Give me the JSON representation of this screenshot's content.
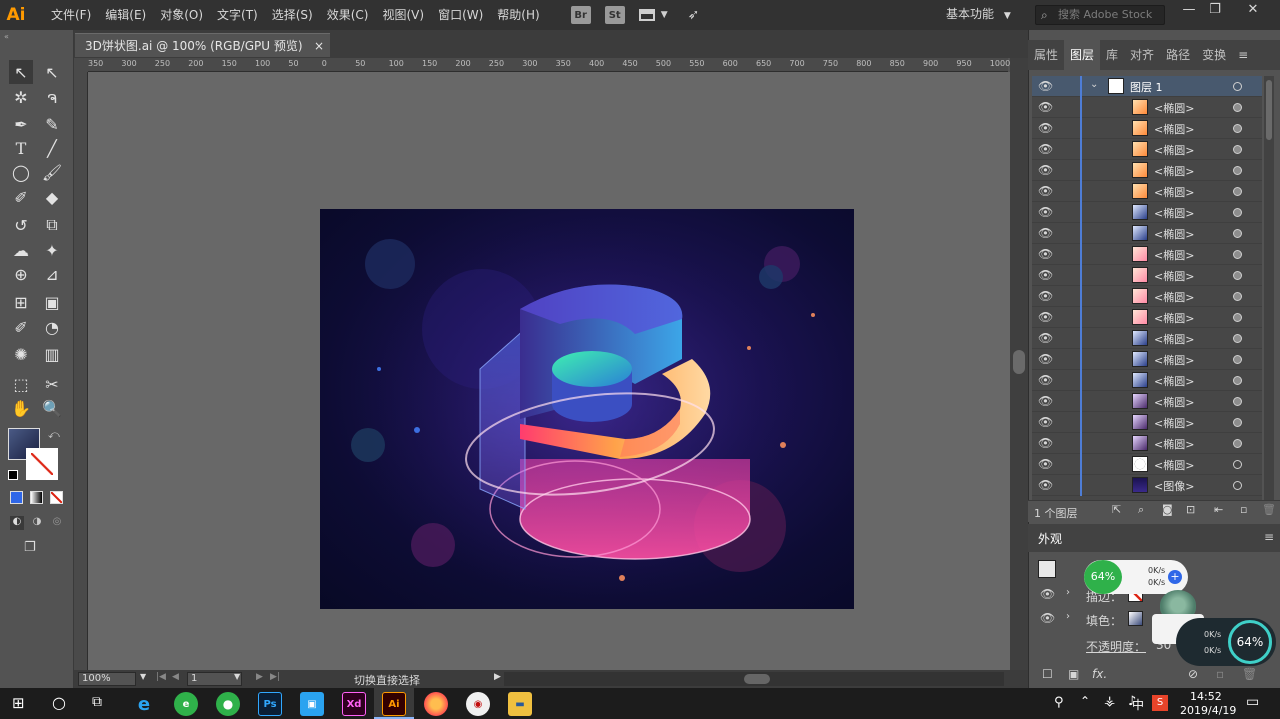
{
  "app": {
    "logo": "Ai",
    "accent": "#ff9a00"
  },
  "menu": [
    "文件(F)",
    "编辑(E)",
    "对象(O)",
    "文字(T)",
    "选择(S)",
    "效果(C)",
    "视图(V)",
    "窗口(W)",
    "帮助(H)"
  ],
  "toolbar_buttons": {
    "bridge": "Br",
    "stock": "St"
  },
  "workspace": {
    "label": "基本功能"
  },
  "search": {
    "placeholder": "搜索 Adobe Stock"
  },
  "document": {
    "tab_title": "3D饼状图.ai @ 100% (RGB/GPU 预览)",
    "close": "×"
  },
  "ruler_ticks": [
    "350",
    "300",
    "250",
    "200",
    "150",
    "100",
    "50",
    "0",
    "50",
    "100",
    "150",
    "200",
    "250",
    "300",
    "350",
    "400",
    "450",
    "500",
    "550",
    "600",
    "650",
    "700",
    "750",
    "800",
    "850",
    "900",
    "950",
    "1000"
  ],
  "status": {
    "zoom": "100%",
    "page": "1",
    "text": "切换直接选择"
  },
  "panel_tabs": [
    "属性",
    "图层",
    "库",
    "对齐",
    "路径",
    "变换"
  ],
  "layers": {
    "header": "图层 1",
    "items": [
      {
        "name": "<椭圆>",
        "thumb": "orange",
        "target": "filled"
      },
      {
        "name": "<椭圆>",
        "thumb": "orange",
        "target": "filled"
      },
      {
        "name": "<椭圆>",
        "thumb": "orange",
        "target": "filled"
      },
      {
        "name": "<椭圆>",
        "thumb": "orange",
        "target": "filled"
      },
      {
        "name": "<椭圆>",
        "thumb": "orange",
        "target": "filled"
      },
      {
        "name": "<椭圆>",
        "thumb": "blue",
        "target": "filled"
      },
      {
        "name": "<椭圆>",
        "thumb": "blue",
        "target": "filled"
      },
      {
        "name": "<椭圆>",
        "thumb": "pink",
        "target": "filled"
      },
      {
        "name": "<椭圆>",
        "thumb": "pink",
        "target": "filled"
      },
      {
        "name": "<椭圆>",
        "thumb": "pink",
        "target": "filled"
      },
      {
        "name": "<椭圆>",
        "thumb": "pink",
        "target": "filled"
      },
      {
        "name": "<椭圆>",
        "thumb": "blue",
        "target": "filled"
      },
      {
        "name": "<椭圆>",
        "thumb": "blue",
        "target": "filled"
      },
      {
        "name": "<椭圆>",
        "thumb": "blue",
        "target": "filled"
      },
      {
        "name": "<椭圆>",
        "thumb": "purple",
        "target": "filled"
      },
      {
        "name": "<椭圆>",
        "thumb": "purple",
        "target": "filled"
      },
      {
        "name": "<椭圆>",
        "thumb": "purple",
        "target": "filled"
      },
      {
        "name": "<椭圆>",
        "thumb": "white",
        "target": "empty"
      },
      {
        "name": "<图像>",
        "thumb": "image",
        "target": "empty"
      }
    ],
    "footer_count": "1 个图层"
  },
  "appearance": {
    "title": "外观",
    "stroke_label": "描边：",
    "fill_label": "填色：",
    "opacity_label": "不透明度：",
    "opacity_value": "30"
  },
  "net_widget": {
    "percent": "64%",
    "up": "0K/s",
    "down": "0K/s"
  },
  "net_widget2": {
    "percent": "64%",
    "up": "0K/s",
    "down": "0K/s"
  },
  "taskbar": {
    "apps": [
      "Ps",
      "Xd",
      "Ai"
    ],
    "ime": "中",
    "time": "14:52",
    "date": "2019/4/19"
  }
}
